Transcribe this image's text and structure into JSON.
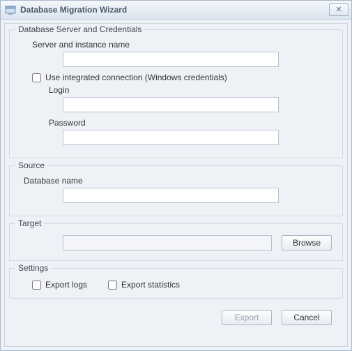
{
  "window": {
    "title": "Database Migration Wizard"
  },
  "credentials": {
    "group_title": "Database Server and Credentials",
    "server_label": "Server and instance name",
    "server_value": "",
    "integrated_label": "Use integrated connection (Windows credentials)",
    "integrated_checked": false,
    "login_label": "Login",
    "login_value": "",
    "password_label": "Password",
    "password_value": ""
  },
  "source": {
    "group_title": "Source",
    "db_label": "Database name",
    "db_value": ""
  },
  "target": {
    "group_title": "Target",
    "path_value": "",
    "browse_label": "Browse"
  },
  "settings": {
    "group_title": "Settings",
    "export_logs_label": "Export logs",
    "export_logs_checked": false,
    "export_stats_label": "Export statistics",
    "export_stats_checked": false
  },
  "buttons": {
    "export_label": "Export",
    "cancel_label": "Cancel"
  }
}
